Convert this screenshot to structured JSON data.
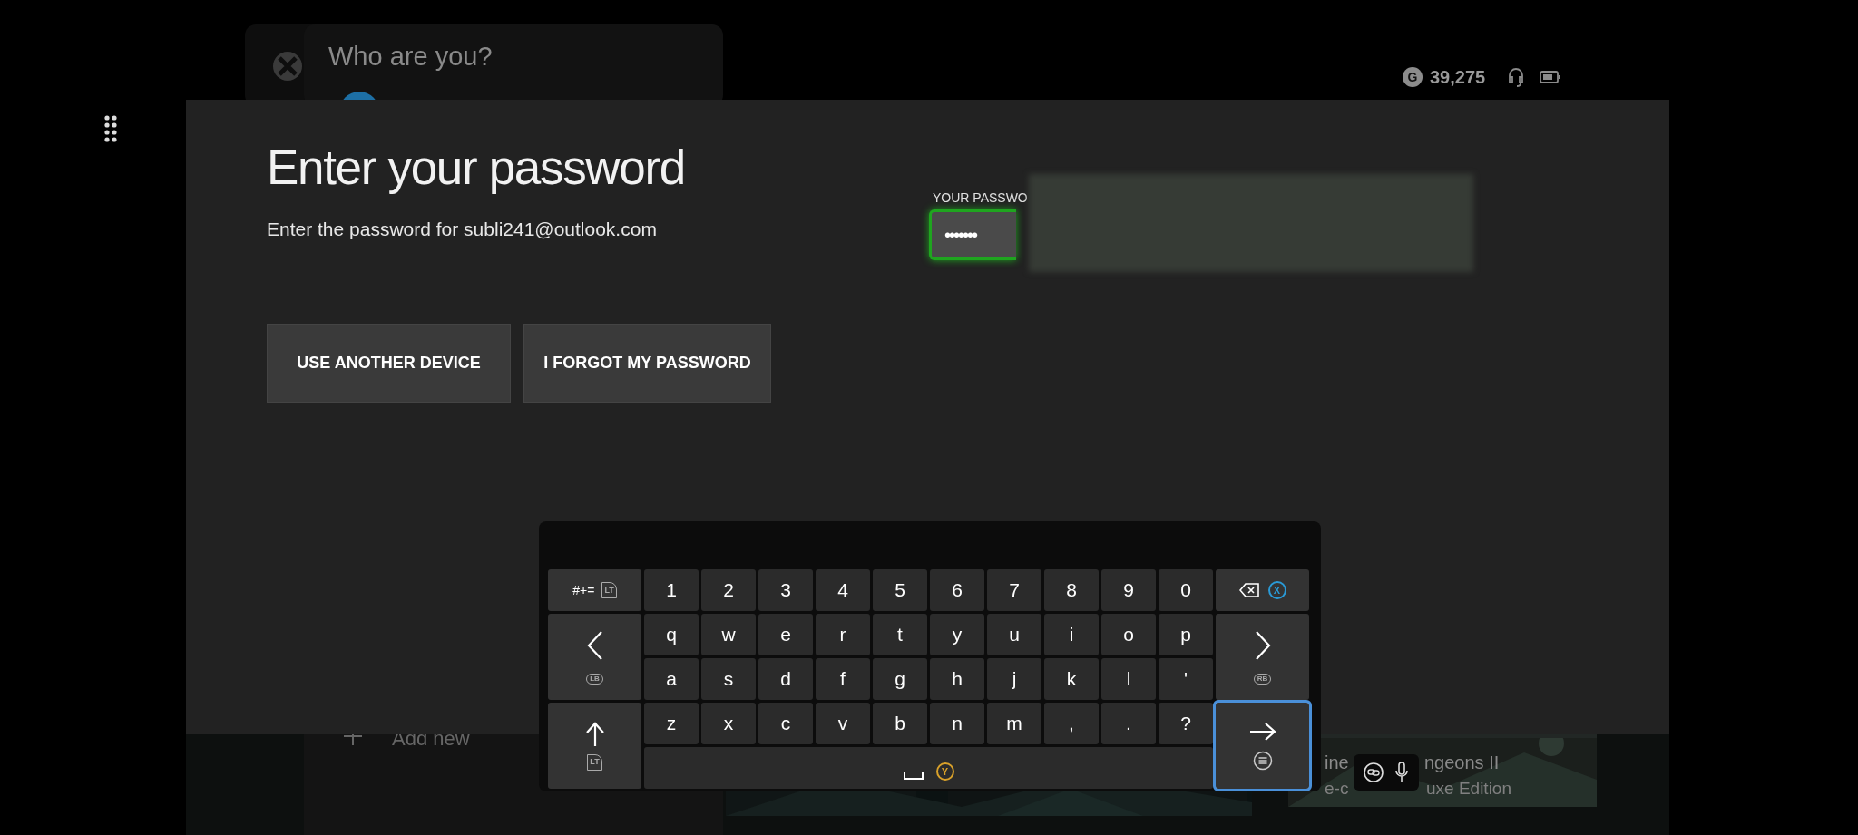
{
  "background": {
    "profile_card": {
      "title": "Who are you?",
      "add_label": "Add new"
    },
    "game_tile": {
      "title_parts": [
        "ine",
        "ngeons II"
      ],
      "subtitle_parts": [
        "e-c",
        "uxe Edition"
      ]
    }
  },
  "status_bar": {
    "badge": "G",
    "gamerscore": "39,275"
  },
  "dialog": {
    "title": "Enter your password",
    "subtitle": "Enter the password for subli241@outlook.com",
    "buttons": [
      "USE ANOTHER DEVICE",
      "I FORGOT MY PASSWORD"
    ],
    "password": {
      "label": "YOUR PASSWO",
      "value": "•••••••",
      "focused": true
    }
  },
  "keyboard": {
    "symbols_key": {
      "label": "#+=",
      "hint": "LT"
    },
    "backspace_key": {
      "hint": "X"
    },
    "left_key": {
      "hint": "LB"
    },
    "right_key": {
      "hint": "RB"
    },
    "shift_key": {
      "hint": "LT"
    },
    "space_key": {
      "hint": "Y"
    },
    "enter_key": {
      "focused": true
    },
    "rows": [
      [
        "1",
        "2",
        "3",
        "4",
        "5",
        "6",
        "7",
        "8",
        "9",
        "0"
      ],
      [
        "q",
        "w",
        "e",
        "r",
        "t",
        "y",
        "u",
        "i",
        "o",
        "p"
      ],
      [
        "a",
        "s",
        "d",
        "f",
        "g",
        "h",
        "j",
        "k",
        "l",
        "'"
      ],
      [
        "z",
        "x",
        "c",
        "v",
        "b",
        "n",
        "m",
        ",",
        ".",
        "?"
      ]
    ]
  }
}
